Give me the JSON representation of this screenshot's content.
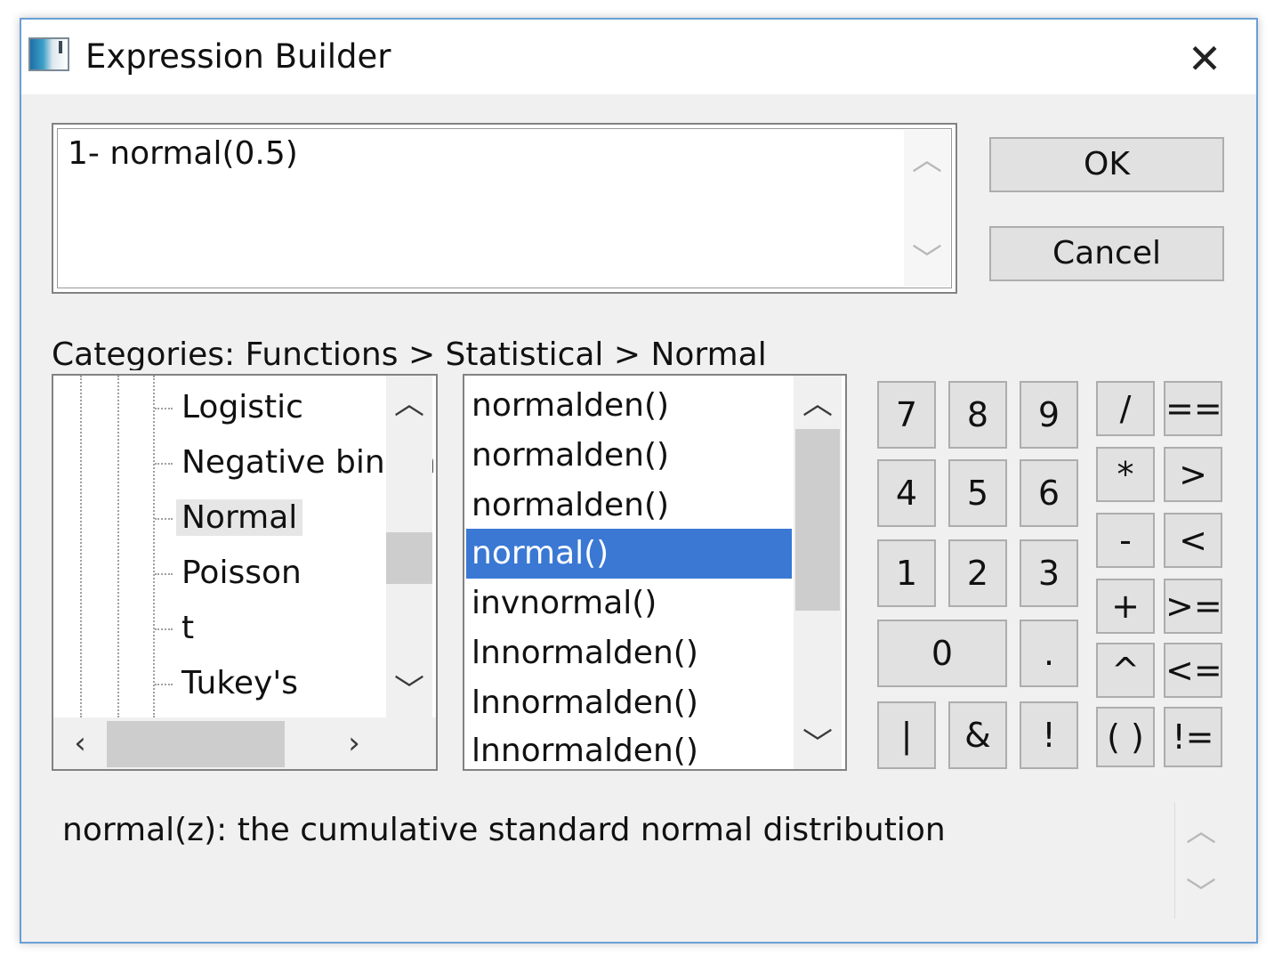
{
  "window": {
    "title": "Expression Builder",
    "close_glyph": "✕"
  },
  "expression": {
    "value": "1- normal(0.5)"
  },
  "buttons": {
    "ok": "OK",
    "cancel": "Cancel"
  },
  "categories": {
    "label": "Categories: Functions > Statistical > Normal"
  },
  "tree": {
    "items": [
      {
        "label": "Logistic"
      },
      {
        "label": "Negative binomial"
      },
      {
        "label": "Normal",
        "selected": true
      },
      {
        "label": "Poisson"
      },
      {
        "label": "t"
      },
      {
        "label": "Tukey's"
      }
    ]
  },
  "functions": {
    "items": [
      {
        "label": "normalden()"
      },
      {
        "label": "normalden()"
      },
      {
        "label": "normalden()"
      },
      {
        "label": "normal()",
        "selected": true
      },
      {
        "label": "invnormal()"
      },
      {
        "label": "lnnormalden()"
      },
      {
        "label": "lnnormalden()"
      },
      {
        "label": "lnnormalden()"
      }
    ]
  },
  "keypad": {
    "k7": "7",
    "k8": "8",
    "k9": "9",
    "k4": "4",
    "k5": "5",
    "k6": "6",
    "k1": "1",
    "k2": "2",
    "k3": "3",
    "k0": "0",
    "dot": ".",
    "pipe": "|",
    "amp": "&",
    "bang": "!",
    "div": "/",
    "mul": "*",
    "sub": "-",
    "add": "+",
    "pow": "^",
    "paren": "( )",
    "eq": "==",
    "gt": ">",
    "lt": "<",
    "ge": ">=",
    "le": "<=",
    "ne": "!="
  },
  "description": {
    "text": "normal(z):  the cumulative standard normal distribution"
  },
  "icons": {
    "up": "︿",
    "down": "﹀",
    "left": "‹",
    "right": "›"
  },
  "colors": {
    "selection": "#3a78d4",
    "window_border": "#6a9fd6"
  }
}
